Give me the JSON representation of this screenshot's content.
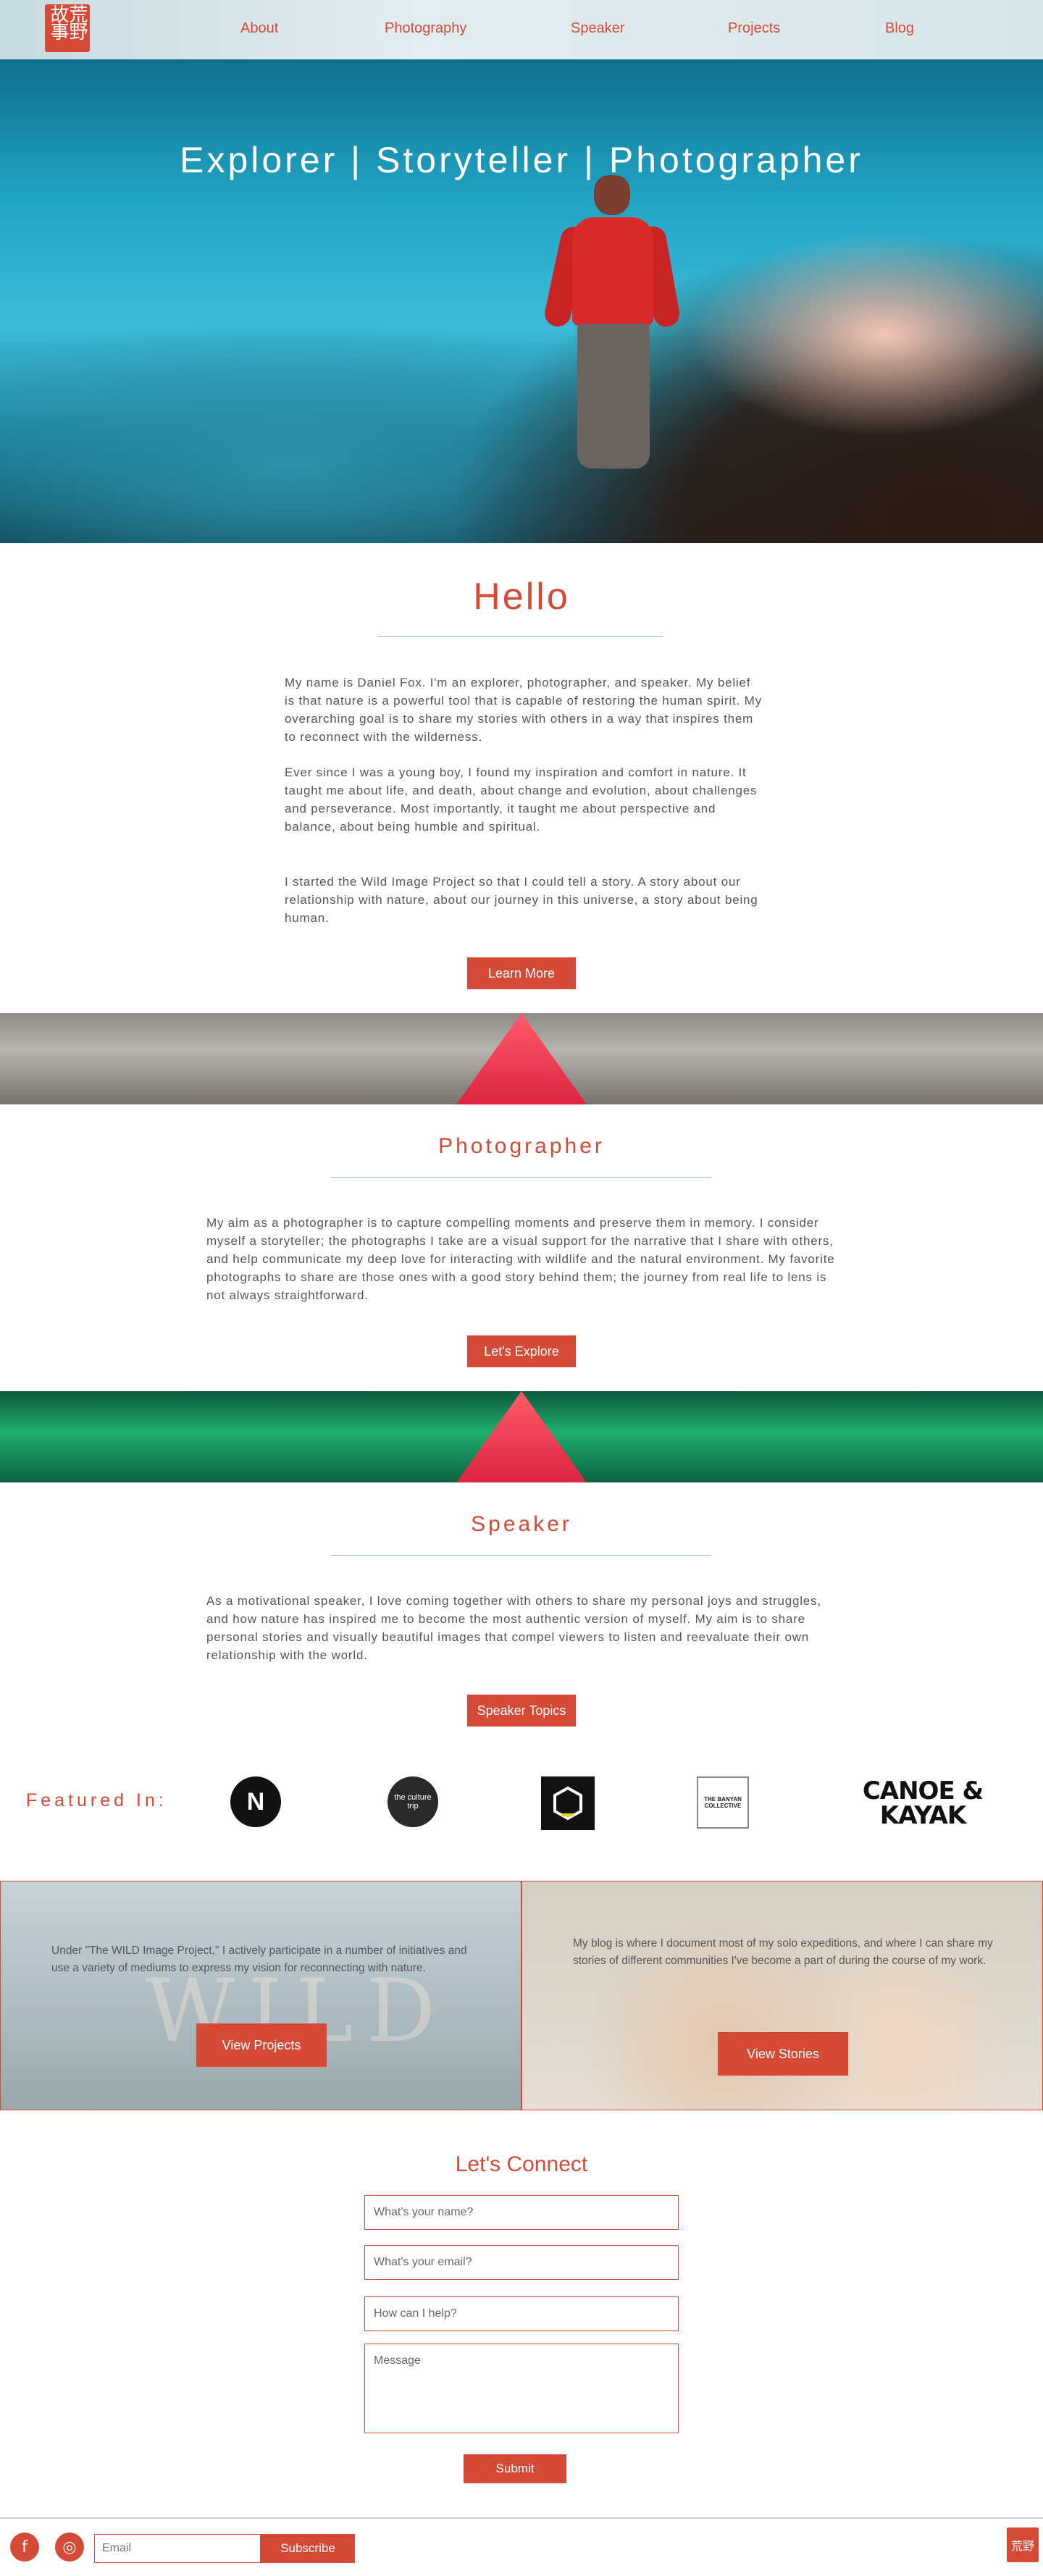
{
  "brand": {
    "logo_text": "荒野故事"
  },
  "nav": {
    "items": [
      {
        "label": "About"
      },
      {
        "label": "Photography"
      },
      {
        "label": "Speaker"
      },
      {
        "label": "Projects"
      },
      {
        "label": "Blog"
      }
    ]
  },
  "hero": {
    "title": "Explorer | Storyteller | Photographer"
  },
  "hello": {
    "title": "Hello",
    "paragraphs": [
      "My name is Daniel Fox. I'm an explorer, photographer, and speaker. My belief is that nature is a powerful tool that is capable of restoring the human spirit. My overarching goal is to share my stories with others in a way that inspires them to reconnect with the wilderness.",
      "Ever since I was a young boy, I found my inspiration and comfort in nature. It taught me about life, and death, about change and evolution, about challenges and perseverance. Most importantly, it taught me about perspective and balance, about being humble and spiritual.",
      "I started the Wild Image Project so that I could tell a story. A story about our relationship with nature, about our journey in this universe, a story about being human."
    ],
    "button": "Learn More"
  },
  "photographer": {
    "title": "Photographer",
    "text": "My aim as a photographer is to capture compelling moments and preserve them in memory. I consider myself a storyteller; the photographs I take are a visual support for the narrative that I share with others, and help communicate my deep love for interacting with wildlife and the natural environment. My favorite photographs to share are those ones with a good story behind them; the journey from real life to lens is not always straightforward.",
    "button": "Let's Explore"
  },
  "speaker": {
    "title": "Speaker",
    "text": "As a motivational speaker, I love coming together with others to share my personal joys and struggles, and how nature has inspired me to become the most authentic version of myself. My aim is to share personal stories and visually beautiful images that compel viewers to listen and reevaluate their own relationship with the world.",
    "button": "Speaker Topics"
  },
  "featured": {
    "label": "Featured In:",
    "logos": [
      {
        "name": "n-circle-logo",
        "text": "N"
      },
      {
        "name": "the-culture-trip-logo",
        "text": "the culture trip"
      },
      {
        "name": "hexagon-logo",
        "text": ""
      },
      {
        "name": "banyan-collective-logo",
        "text": "THE BANYAN COLLECTIVE"
      },
      {
        "name": "canoe-kayak-logo",
        "text": "CANOE & KAYAK"
      }
    ]
  },
  "projects_card": {
    "text": "Under \"The WILD Image Project,\" I actively participate in a number of initiatives and use a variety of mediums to express my vision for reconnecting with nature.",
    "button": "View Projects",
    "watermark": "WILD"
  },
  "blog_card": {
    "text": "My blog is where I document most of my solo expeditions, and where I can share my stories of different communities I've become a part of during the course of my work.",
    "button": "View Stories"
  },
  "connect": {
    "title": "Let's Connect",
    "name_placeholder": "What's your name?",
    "email_placeholder": "What's your email?",
    "help_placeholder": "How can I help?",
    "message_placeholder": "Message",
    "submit": "Submit"
  },
  "footer": {
    "facebook_icon": "f",
    "instagram_icon": "◎",
    "email_placeholder": "Email",
    "subscribe": "Subscribe",
    "logo_text": "荒野"
  },
  "colors": {
    "accent": "#d44a36",
    "rule": "#9fb7c4"
  }
}
